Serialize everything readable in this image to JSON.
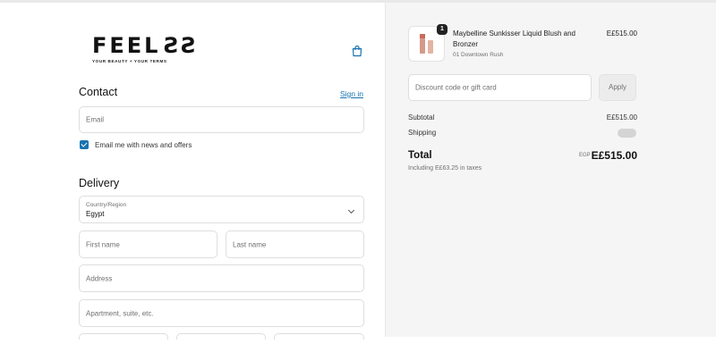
{
  "brand": {
    "logo_text_main": "FEEL",
    "logo_text_flip": "SS",
    "tagline": "YOUR BEAUTY + YOUR TERMS"
  },
  "contact": {
    "title": "Contact",
    "signin_label": "Sign in",
    "email_placeholder": "Email",
    "newsletter_label": "Email me with news and offers",
    "newsletter_checked": true
  },
  "delivery": {
    "title": "Delivery",
    "country_label": "Country/Region",
    "country_value": "Egypt",
    "first_name_placeholder": "First name",
    "last_name_placeholder": "Last name",
    "address_placeholder": "Address",
    "apartment_placeholder": "Apartment, suite, etc."
  },
  "order_summary": {
    "item": {
      "quantity": "1",
      "name": "Maybelline Sunkisser Liquid Blush and Bronzer",
      "variant": "01 Downtown Rush",
      "price": "E£515.00"
    },
    "discount_placeholder": "Discount code or gift card",
    "apply_label": "Apply",
    "subtotal_label": "Subtotal",
    "subtotal_value": "E£515.00",
    "shipping_label": "Shipping",
    "total_label": "Total",
    "currency": "EGP",
    "total_value": "E£515.00",
    "taxes_note": "Including E£63.25 in taxes"
  },
  "colors": {
    "accent": "#1773b0",
    "summary_bg": "#f5f5f5"
  }
}
